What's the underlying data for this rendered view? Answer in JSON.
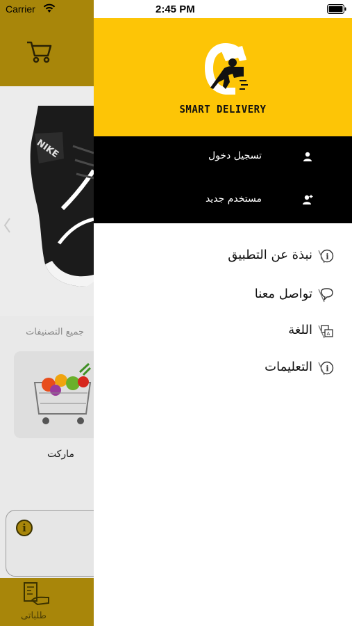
{
  "status_bar": {
    "carrier": "Carrier",
    "time": "2:45 PM"
  },
  "background": {
    "all_categories": "جميع التصنيفات",
    "category_label": "ماركت",
    "tab_orders_label": "طلباتى"
  },
  "drawer": {
    "logo_text": "SMART DELIVERY",
    "auth": [
      {
        "label": "تسجيل دخول",
        "icon": "user-icon"
      },
      {
        "label": "مستخدم جديد",
        "icon": "add-user-icon"
      }
    ],
    "menu": [
      {
        "label": "نبذة عن التطبيق",
        "icon": "info-icon"
      },
      {
        "label": "تواصل معنا",
        "icon": "chat-bubble-icon"
      },
      {
        "label": "اللغة",
        "icon": "language-icon"
      },
      {
        "label": "التعليمات",
        "icon": "info-icon"
      }
    ]
  },
  "colors": {
    "header_yellow": "#fdc506",
    "auth_black": "#000000",
    "dim_gold": "#a8860a"
  }
}
